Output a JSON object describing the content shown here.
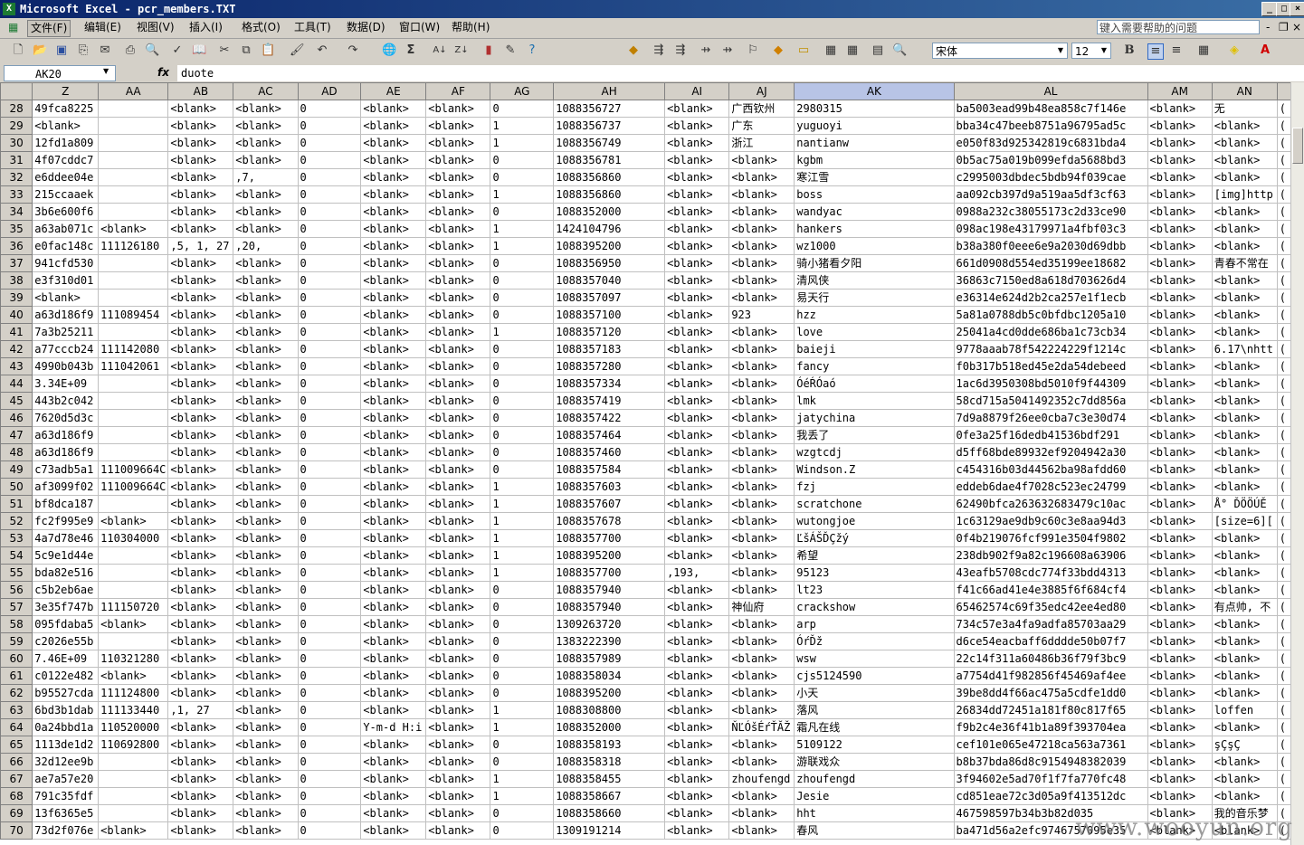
{
  "window": {
    "title": "Microsoft Excel - pcr_members.TXT",
    "app_icon": "X",
    "minimize": "_",
    "restore": "□",
    "close": "×"
  },
  "menu": [
    "文件(F)",
    "编辑(E)",
    "视图(V)",
    "插入(I)",
    "格式(O)",
    "工具(T)",
    "数据(D)",
    "窗口(W)",
    "帮助(H)"
  ],
  "help_placeholder": "键入需要帮助的问题",
  "toolbar": {
    "font": "宋体",
    "size": "12",
    "bold": "B"
  },
  "formula_bar": {
    "cell_ref": "AK20",
    "fx": "fx",
    "value": "duote"
  },
  "selected_column": "AK",
  "columns": [
    "Z",
    "AA",
    "AB",
    "AC",
    "AD",
    "AE",
    "AF",
    "AG",
    "AH",
    "AI",
    "AJ",
    "AK",
    "AL",
    "AM",
    "AN",
    ""
  ],
  "rows": [
    [
      "28",
      "49fca8225",
      "",
      "<blank>",
      "<blank>",
      "0",
      "<blank>",
      "<blank>",
      "0",
      "1088356727",
      "<blank>",
      "广西钦州",
      "2980315",
      "ba5003ead99b48ea858c7f146e",
      "<blank>",
      "无",
      "("
    ],
    [
      "29",
      "<blank>",
      "",
      "<blank>",
      "<blank>",
      "0",
      "<blank>",
      "<blank>",
      "1",
      "1088356737",
      "<blank>",
      "广东",
      "yuguoyi",
      "bba34c47beeb8751a96795ad5c",
      "<blank>",
      "<blank>",
      "("
    ],
    [
      "30",
      "12fd1a809",
      "",
      "<blank>",
      "<blank>",
      "0",
      "<blank>",
      "<blank>",
      "1",
      "1088356749",
      "<blank>",
      "浙江",
      "nantianw",
      "e050f83d925342819c6831bda4",
      "<blank>",
      "<blank>",
      "("
    ],
    [
      "31",
      "4f07cddc7",
      "",
      "<blank>",
      "<blank>",
      "0",
      "<blank>",
      "<blank>",
      "0",
      "1088356781",
      "<blank>",
      "<blank>",
      "kgbm",
      "0b5ac75a019b099efda5688bd3",
      "<blank>",
      "<blank>",
      "("
    ],
    [
      "32",
      "e6ddee04e",
      "",
      "<blank>",
      ",7,",
      "0",
      "<blank>",
      "<blank>",
      "0",
      "1088356860",
      "<blank>",
      "<blank>",
      "寒江雪",
      "c2995003dbdec5bdb94f039cae",
      "<blank>",
      "<blank>",
      "("
    ],
    [
      "33",
      "215ccaaek",
      "",
      "<blank>",
      "<blank>",
      "0",
      "<blank>",
      "<blank>",
      "1",
      "1088356860",
      "<blank>",
      "<blank>",
      "boss",
      "aa092cb397d9a519aa5df3cf63",
      "<blank>",
      "[img]http",
      "("
    ],
    [
      "34",
      "3b6e600f6",
      "",
      "<blank>",
      "<blank>",
      "0",
      "<blank>",
      "<blank>",
      "0",
      "1088352000",
      "<blank>",
      "<blank>",
      "wandyac",
      "0988a232c38055173c2d33ce90",
      "<blank>",
      "<blank>",
      "("
    ],
    [
      "35",
      "a63ab071c",
      "<blank>",
      "<blank>",
      "<blank>",
      "0",
      "<blank>",
      "<blank>",
      "1",
      "1424104796",
      "<blank>",
      "<blank>",
      "hankers",
      "098ac198e43179971a4fbf03c3",
      "<blank>",
      "<blank>",
      "("
    ],
    [
      "36",
      "e0fac148c",
      "111126180",
      ",5, 1, 27",
      ",20,",
      "0",
      "<blank>",
      "<blank>",
      "1",
      "1088395200",
      "<blank>",
      "<blank>",
      "wz1000",
      "b38a380f0eee6e9a2030d69dbb",
      "<blank>",
      "<blank>",
      "("
    ],
    [
      "37",
      "941cfd530",
      "",
      "<blank>",
      "<blank>",
      "0",
      "<blank>",
      "<blank>",
      "0",
      "1088356950",
      "<blank>",
      "<blank>",
      "骑小猪看夕阳",
      "661d0908d554ed35199ee18682",
      "<blank>",
      "青春不常在",
      "("
    ],
    [
      "38",
      "e3f310d01",
      "",
      "<blank>",
      "<blank>",
      "0",
      "<blank>",
      "<blank>",
      "0",
      "1088357040",
      "<blank>",
      "<blank>",
      "清风侠",
      "36863c7150ed8a618d703626d4",
      "<blank>",
      "<blank>",
      "("
    ],
    [
      "39",
      "<blank>",
      "",
      "<blank>",
      "<blank>",
      "0",
      "<blank>",
      "<blank>",
      "0",
      "1088357097",
      "<blank>",
      "<blank>",
      "易天行",
      "e36314e624d2b2ca257e1f1ecb",
      "<blank>",
      "<blank>",
      "("
    ],
    [
      "40",
      "a63d186f9",
      "111089454",
      "<blank>",
      "<blank>",
      "0",
      "<blank>",
      "<blank>",
      "0",
      "1088357100",
      "<blank>",
      "923",
      "hzz",
      "5a81a0788db5c0bfdbc1205a10",
      "<blank>",
      "<blank>",
      "("
    ],
    [
      "41",
      "7a3b25211",
      "",
      "<blank>",
      "<blank>",
      "0",
      "<blank>",
      "<blank>",
      "1",
      "1088357120",
      "<blank>",
      "<blank>",
      "love",
      "25041a4cd0dde686ba1c73cb34",
      "<blank>",
      "<blank>",
      "("
    ],
    [
      "42",
      "a77cccb24",
      "111142080",
      "<blank>",
      "<blank>",
      "0",
      "<blank>",
      "<blank>",
      "0",
      "1088357183",
      "<blank>",
      "<blank>",
      "baieji",
      "9778aaab78f542224229f1214c",
      "<blank>",
      "6.17\\nhtt",
      "("
    ],
    [
      "43",
      "4990b043b",
      "111042061",
      "<blank>",
      "<blank>",
      "0",
      "<blank>",
      "<blank>",
      "0",
      "1088357280",
      "<blank>",
      "<blank>",
      "fancy",
      "f0b317b518ed45e2da54debeed",
      "<blank>",
      "<blank>",
      "("
    ],
    [
      "44",
      "3.34E+09",
      "",
      "<blank>",
      "<blank>",
      "0",
      "<blank>",
      "<blank>",
      "0",
      "1088357334",
      "<blank>",
      "<blank>",
      "ÓéŔÓaó",
      "1ac6d3950308bd5010f9f44309",
      "<blank>",
      "<blank>",
      "("
    ],
    [
      "45",
      "443b2c042",
      "",
      "<blank>",
      "<blank>",
      "0",
      "<blank>",
      "<blank>",
      "0",
      "1088357419",
      "<blank>",
      "<blank>",
      "lmk",
      "58cd715a5041492352c7dd856a",
      "<blank>",
      "<blank>",
      "("
    ],
    [
      "46",
      "7620d5d3c",
      "",
      "<blank>",
      "<blank>",
      "0",
      "<blank>",
      "<blank>",
      "0",
      "1088357422",
      "<blank>",
      "<blank>",
      "jatychina",
      "7d9a8879f26ee0cba7c3e30d74",
      "<blank>",
      "<blank>",
      "("
    ],
    [
      "47",
      "a63d186f9",
      "",
      "<blank>",
      "<blank>",
      "0",
      "<blank>",
      "<blank>",
      "0",
      "1088357464",
      "<blank>",
      "<blank>",
      "我丢了",
      "0fe3a25f16dedb41536bdf291",
      "<blank>",
      "<blank>",
      "("
    ],
    [
      "48",
      "a63d186f9",
      "",
      "<blank>",
      "<blank>",
      "0",
      "<blank>",
      "<blank>",
      "0",
      "1088357460",
      "<blank>",
      "<blank>",
      "wzgtcdj",
      "d5ff68bde89932ef9204942a30",
      "<blank>",
      "<blank>",
      "("
    ],
    [
      "49",
      "c73adb5a1",
      "111009664C",
      "<blank>",
      "<blank>",
      "0",
      "<blank>",
      "<blank>",
      "0",
      "1088357584",
      "<blank>",
      "<blank>",
      "Windson.Z",
      "c454316b03d44562ba98afdd60",
      "<blank>",
      "<blank>",
      "("
    ],
    [
      "50",
      "af3099f02",
      "111009664C",
      "<blank>",
      "<blank>",
      "0",
      "<blank>",
      "<blank>",
      "1",
      "1088357603",
      "<blank>",
      "<blank>",
      "fzj",
      "eddeb6dae4f7028c523ec24799",
      "<blank>",
      "<blank>",
      "("
    ],
    [
      "51",
      "bf8dca187",
      "",
      "<blank>",
      "<blank>",
      "0",
      "<blank>",
      "<blank>",
      "1",
      "1088357607",
      "<blank>",
      "<blank>",
      "scratchone",
      "62490bfca263632683479c10ac",
      "<blank>",
      "Å° ĎÖÖÚĚ",
      "("
    ],
    [
      "52",
      "fc2f995e9",
      "<blank>",
      "<blank>",
      "<blank>",
      "0",
      "<blank>",
      "<blank>",
      "1",
      "1088357678",
      "<blank>",
      "<blank>",
      "wutongjoe",
      "1c63129ae9db9c60c3e8aa94d3",
      "<blank>",
      "[size=6][",
      "("
    ],
    [
      "53",
      "4a7d78e46",
      "110304000",
      "<blank>",
      "<blank>",
      "0",
      "<blank>",
      "<blank>",
      "1",
      "1088357700",
      "<blank>",
      "<blank>",
      "ĽšÁŠĎÇžý",
      "0f4b219076fcf991e3504f9802",
      "<blank>",
      "<blank>",
      "("
    ],
    [
      "54",
      "5c9e1d44e",
      "",
      "<blank>",
      "<blank>",
      "0",
      "<blank>",
      "<blank>",
      "1",
      "1088395200",
      "<blank>",
      "<blank>",
      "希望",
      "238db902f9a82c196608a63906",
      "<blank>",
      "<blank>",
      "("
    ],
    [
      "55",
      "bda82e516",
      "",
      "<blank>",
      "<blank>",
      "0",
      "<blank>",
      "<blank>",
      "1",
      "1088357700",
      ",193,",
      "<blank>",
      "95123",
      "43eafb5708cdc774f33bdd4313",
      "<blank>",
      "<blank>",
      "("
    ],
    [
      "56",
      "c5b2eb6ae",
      "",
      "<blank>",
      "<blank>",
      "0",
      "<blank>",
      "<blank>",
      "0",
      "1088357940",
      "<blank>",
      "<blank>",
      "lt23",
      "f41c66ad41e4e3885f6f684cf4",
      "<blank>",
      "<blank>",
      "("
    ],
    [
      "57",
      "3e35f747b",
      "111150720",
      "<blank>",
      "<blank>",
      "0",
      "<blank>",
      "<blank>",
      "0",
      "1088357940",
      "<blank>",
      "神仙府",
      "crackshow",
      "65462574c69f35edc42ee4ed80",
      "<blank>",
      "有点帅, 不",
      "("
    ],
    [
      "58",
      "095fdaba5",
      "<blank>",
      "<blank>",
      "<blank>",
      "0",
      "<blank>",
      "<blank>",
      "0",
      "1309263720",
      "<blank>",
      "<blank>",
      "arp",
      "734c57e3a4fa9adfa85703aa29",
      "<blank>",
      "<blank>",
      "("
    ],
    [
      "59",
      "c2026e55b",
      "",
      "<blank>",
      "<blank>",
      "0",
      "<blank>",
      "<blank>",
      "0",
      "1383222390",
      "<blank>",
      "<blank>",
      "ÓŕĎž",
      "d6ce54eacbaff6dddde50b07f7",
      "<blank>",
      "<blank>",
      "("
    ],
    [
      "60",
      "7.46E+09",
      "110321280",
      "<blank>",
      "<blank>",
      "0",
      "<blank>",
      "<blank>",
      "0",
      "1088357989",
      "<blank>",
      "<blank>",
      "wsw",
      "22c14f311a60486b36f79f3bc9",
      "<blank>",
      "<blank>",
      "("
    ],
    [
      "61",
      "c0122e482",
      "<blank>",
      "<blank>",
      "<blank>",
      "0",
      "<blank>",
      "<blank>",
      "0",
      "1088358034",
      "<blank>",
      "<blank>",
      "cjs5124590",
      "a7754d41f982856f45469af4ee",
      "<blank>",
      "<blank>",
      "("
    ],
    [
      "62",
      "b95527cda",
      "111124800",
      "<blank>",
      "<blank>",
      "0",
      "<blank>",
      "<blank>",
      "0",
      "1088395200",
      "<blank>",
      "<blank>",
      "小天",
      "39be8dd4f66ac475a5cdfe1dd0",
      "<blank>",
      "<blank>",
      "("
    ],
    [
      "63",
      "6bd3b1dab",
      "111133440",
      ",1, 27",
      "<blank>",
      "0",
      "<blank>",
      "<blank>",
      "1",
      "1088308800",
      "<blank>",
      "<blank>",
      "落风",
      "26834dd72451a181f80c817f65",
      "<blank>",
      "loffen",
      "("
    ],
    [
      "64",
      "0a24bbd1a",
      "110520000",
      "<blank>",
      "<blank>",
      "0",
      "Y-m-d H:i",
      "<blank>",
      "1",
      "1088352000",
      "<blank>",
      "ŇĽÓšÉŕŤĂŽ",
      "霜凡在线",
      "f9b2c4e36f41b1a89f393704ea",
      "<blank>",
      "<blank>",
      "("
    ],
    [
      "65",
      "1113de1d2",
      "110692800",
      "<blank>",
      "<blank>",
      "0",
      "<blank>",
      "<blank>",
      "0",
      "1088358193",
      "<blank>",
      "<blank>",
      "5109122",
      "cef101e065e47218ca563a7361",
      "<blank>",
      "şÇşÇ",
      "("
    ],
    [
      "66",
      "32d12ee9b",
      "",
      "<blank>",
      "<blank>",
      "0",
      "<blank>",
      "<blank>",
      "0",
      "1088358318",
      "<blank>",
      "<blank>",
      "游联戏众",
      "b8b37bda86d8c9154948382039",
      "<blank>",
      "<blank>",
      "("
    ],
    [
      "67",
      "ae7a57e20",
      "",
      "<blank>",
      "<blank>",
      "0",
      "<blank>",
      "<blank>",
      "1",
      "1088358455",
      "<blank>",
      "zhoufengd",
      "zhoufengd",
      "3f94602e5ad70f1f7fa770fc48",
      "<blank>",
      "<blank>",
      "("
    ],
    [
      "68",
      "791c35fdf",
      "",
      "<blank>",
      "<blank>",
      "0",
      "<blank>",
      "<blank>",
      "1",
      "1088358667",
      "<blank>",
      "<blank>",
      "Jesie",
      "cd851eae72c3d05a9f413512dc",
      "<blank>",
      "<blank>",
      "("
    ],
    [
      "69",
      "13f6365e5",
      "",
      "<blank>",
      "<blank>",
      "0",
      "<blank>",
      "<blank>",
      "0",
      "1088358660",
      "<blank>",
      "<blank>",
      "hht",
      "467598597b34b3b82d035",
      "<blank>",
      "我的音乐梦",
      "("
    ],
    [
      "70",
      "73d2f076e",
      "<blank>",
      "<blank>",
      "<blank>",
      "0",
      "<blank>",
      "<blank>",
      "0",
      "1309191214",
      "<blank>",
      "<blank>",
      "春风",
      "ba471d56a2efc9746757095e35",
      "<blank>",
      "<blank>",
      "("
    ]
  ],
  "watermark": "www.wooyun.org"
}
